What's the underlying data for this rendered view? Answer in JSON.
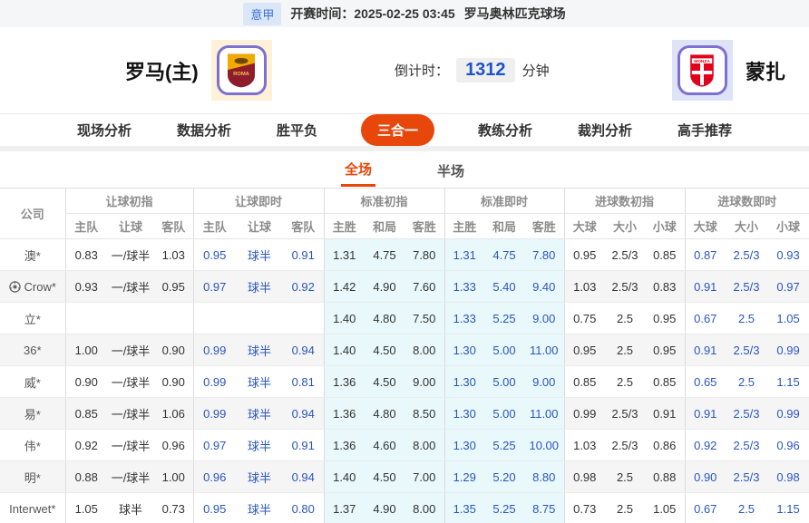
{
  "topbar": {
    "league": "意甲",
    "kickoff_label": "开赛时间：",
    "kickoff_time": "2025-02-25 03:45",
    "venue": "罗马奥林匹克球场"
  },
  "match": {
    "home_team": "罗马(主)",
    "away_team": "蒙扎",
    "countdown_label": "倒计时：",
    "countdown_value": "1312",
    "countdown_unit": "分钟"
  },
  "nav": {
    "items": [
      {
        "label": "现场分析"
      },
      {
        "label": "数据分析"
      },
      {
        "label": "胜平负"
      },
      {
        "label": "三合一"
      },
      {
        "label": "教练分析"
      },
      {
        "label": "裁判分析"
      },
      {
        "label": "高手推荐"
      }
    ],
    "active": "三合一"
  },
  "subtabs": {
    "items": [
      {
        "label": "全场"
      },
      {
        "label": "半场"
      }
    ],
    "active": "全场"
  },
  "table": {
    "company_header": "公司",
    "groups": [
      {
        "label": "让球初指",
        "cols": [
          "主队",
          "让球",
          "客队"
        ]
      },
      {
        "label": "让球即时",
        "cols": [
          "主队",
          "让球",
          "客队"
        ]
      },
      {
        "label": "标准初指",
        "cols": [
          "主胜",
          "和局",
          "客胜"
        ]
      },
      {
        "label": "标准即时",
        "cols": [
          "主胜",
          "和局",
          "客胜"
        ]
      },
      {
        "label": "进球数初指",
        "cols": [
          "大球",
          "大小",
          "小球"
        ]
      },
      {
        "label": "进球数即时",
        "cols": [
          "大球",
          "大小",
          "小球"
        ]
      }
    ],
    "rows": [
      {
        "company": "澳*",
        "icon": false,
        "cells": [
          "0.83",
          "一/球半",
          "1.03",
          "0.95",
          "球半",
          "0.91",
          "1.31",
          "4.75",
          "7.80",
          "1.31",
          "4.75",
          "7.80",
          "0.95",
          "2.5/3",
          "0.85",
          "0.87",
          "2.5/3",
          "0.93"
        ]
      },
      {
        "company": "Crow*",
        "icon": true,
        "cells": [
          "0.93",
          "一/球半",
          "0.95",
          "0.97",
          "球半",
          "0.92",
          "1.42",
          "4.90",
          "7.60",
          "1.33",
          "5.40",
          "9.40",
          "1.03",
          "2.5/3",
          "0.83",
          "0.91",
          "2.5/3",
          "0.97"
        ]
      },
      {
        "company": "立*",
        "icon": false,
        "cells": [
          "",
          "",
          "",
          "",
          "",
          "",
          "1.40",
          "4.80",
          "7.50",
          "1.33",
          "5.25",
          "9.00",
          "0.75",
          "2.5",
          "0.95",
          "0.67",
          "2.5",
          "1.05"
        ]
      },
      {
        "company": "36*",
        "icon": false,
        "cells": [
          "1.00",
          "一/球半",
          "0.90",
          "0.99",
          "球半",
          "0.94",
          "1.40",
          "4.50",
          "8.00",
          "1.30",
          "5.00",
          "11.00",
          "0.95",
          "2.5",
          "0.95",
          "0.91",
          "2.5/3",
          "0.99"
        ]
      },
      {
        "company": "威*",
        "icon": false,
        "cells": [
          "0.90",
          "一/球半",
          "0.90",
          "0.99",
          "球半",
          "0.81",
          "1.36",
          "4.50",
          "9.00",
          "1.30",
          "5.00",
          "9.00",
          "0.85",
          "2.5",
          "0.85",
          "0.65",
          "2.5",
          "1.15"
        ]
      },
      {
        "company": "易*",
        "icon": false,
        "cells": [
          "0.85",
          "一/球半",
          "1.06",
          "0.99",
          "球半",
          "0.94",
          "1.36",
          "4.80",
          "8.50",
          "1.30",
          "5.00",
          "11.00",
          "0.99",
          "2.5/3",
          "0.91",
          "0.91",
          "2.5/3",
          "0.99"
        ]
      },
      {
        "company": "伟*",
        "icon": false,
        "cells": [
          "0.92",
          "一/球半",
          "0.96",
          "0.97",
          "球半",
          "0.91",
          "1.36",
          "4.60",
          "8.00",
          "1.30",
          "5.25",
          "10.00",
          "1.03",
          "2.5/3",
          "0.86",
          "0.92",
          "2.5/3",
          "0.96"
        ]
      },
      {
        "company": "明*",
        "icon": false,
        "cells": [
          "0.88",
          "一/球半",
          "1.00",
          "0.96",
          "球半",
          "0.94",
          "1.40",
          "4.50",
          "7.00",
          "1.29",
          "5.20",
          "8.80",
          "0.98",
          "2.5",
          "0.88",
          "0.90",
          "2.5/3",
          "0.98"
        ]
      },
      {
        "company": "Interwet*",
        "icon": false,
        "cells": [
          "1.05",
          "球半",
          "0.73",
          "0.95",
          "球半",
          "0.80",
          "1.37",
          "4.90",
          "8.00",
          "1.35",
          "5.25",
          "8.75",
          "0.73",
          "2.5",
          "1.05",
          "0.67",
          "2.5",
          "1.15"
        ]
      }
    ]
  },
  "colors": {
    "accent_orange": "#e8470b",
    "live_odds_blue": "#2a56c0",
    "league_badge_bg": "#dbe7f9",
    "league_badge_text": "#3a6fd8",
    "countdown_blue": "#1d53c9",
    "tint_cyan": "#e9f8fa",
    "stripe_gray": "#f5f5f5",
    "logo_border_purple": "#7e70d2",
    "home_logo_bg": "#fdf1d7",
    "away_logo_bg": "#dfe3f8"
  }
}
